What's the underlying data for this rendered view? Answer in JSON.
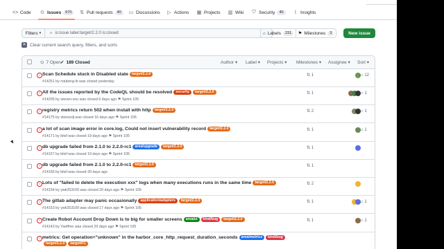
{
  "repo_tabs": {
    "code": "Code",
    "issues": "Issues",
    "issues_count": "670",
    "pulls": "Pull requests",
    "pulls_count": "40",
    "discussions": "Discussions",
    "actions": "Actions",
    "projects": "Projects",
    "wiki": "Wiki",
    "security": "Security",
    "security_count": "40",
    "insights": "Insights"
  },
  "filter_bar": {
    "filters_label": "Filters",
    "search_value": "is:issue label:target/2.2.0 is:closed",
    "labels_label": "Labels",
    "labels_count": "231",
    "milestones_label": "Milestones",
    "milestones_count": "3",
    "new_issue_label": "New issue"
  },
  "clear_text": "Clear current search query, filters, and sorts",
  "list_header": {
    "open": "7 Open",
    "closed": "189 Closed",
    "author": "Author",
    "label": "Label",
    "projects": "Projects",
    "milestones": "Milestones",
    "assignee": "Assignee",
    "sort": "Sort"
  },
  "label_colors": {
    "target": "#e46a1a",
    "security": "#d93f0b",
    "area": "#1f6feb",
    "application": "#d93f0b",
    "kind_bug": "#d73a4a",
    "area_ui": "#0e8a16",
    "area_metrics": "#1f6feb"
  },
  "issues": [
    {
      "title": "Scan Schedule stuck in Disabled state",
      "labels": [
        "target/2.2.0"
      ],
      "label_keys": [
        "target"
      ],
      "meta": "#14251 by rstuberg-ib was closed yesterday",
      "sprint": "",
      "prs": "1",
      "avatars": [
        "#6a9955"
      ],
      "comments": "12"
    },
    {
      "title": "All the issues reported by the CodeQL should be resolved",
      "labels": [
        "security",
        "target/2.2.0"
      ],
      "label_keys": [
        "security",
        "target"
      ],
      "meta": "#14205 by steven-zou was closed 6 days ago",
      "sprint": "Sprint 105",
      "prs": "1",
      "avatars": [
        "#8b6c4f",
        "#4a7a4a",
        "#333333"
      ],
      "comments": "1"
    },
    {
      "title": "registry metrics return 502 when install with http",
      "labels": [
        "target/2.2.0"
      ],
      "label_keys": [
        "target"
      ],
      "meta": "#14175 by stonezdj was closed 16 days ago",
      "sprint": "Sprint 105",
      "prs": "2",
      "avatars": [
        "#7a8a6a",
        "#333333"
      ],
      "comments": "1"
    },
    {
      "title": "a lot of scan image error in core.log, Could not insert vulnerability record",
      "labels": [
        "target/2.2.0"
      ],
      "label_keys": [
        "target"
      ],
      "meta": "#14171 by bitsf was closed 19 days ago",
      "sprint": "Sprint 105",
      "prs": "1",
      "avatars": [
        "#6a8a5a"
      ],
      "comments": "1"
    },
    {
      "title": "db upgrade failed from 2.1.0 to 2.2.0-rc1",
      "labels": [
        "area/upgrade",
        "target/2.2.0"
      ],
      "label_keys": [
        "area",
        "target"
      ],
      "meta": "#14157 by bitsf was closed 19 days ago",
      "sprint": "Sprint 105",
      "prs": "1",
      "avatars": [
        "#5b6ee1"
      ],
      "comments": ""
    },
    {
      "title": "db upgrade failed from 2.1.0 to 2.2.0-rc1",
      "labels": [
        "target/2.2.0"
      ],
      "label_keys": [
        "target"
      ],
      "meta": "#14156 by bitsf was closed 20 days ago",
      "sprint": "",
      "prs": "1",
      "avatars": [],
      "comments": ""
    },
    {
      "title": "Lots of \"failed to delete the execution xxx\" logs when many executions runs in the same time",
      "labels": [
        "target/2.2.0"
      ],
      "label_keys": [
        "target"
      ],
      "meta": "#14154 by ywk253100 was closed 20 days ago",
      "sprint": "Sprint 105",
      "prs": "2",
      "avatars": [
        "#f2b233"
      ],
      "comments": ""
    },
    {
      "title": "The gitlab adapter may panic occasionally",
      "labels": [
        "application/adapters",
        "target/2.2.0"
      ],
      "label_keys": [
        "application",
        "target"
      ],
      "meta": "#14153 by ywk253100 was closed 17 days ago",
      "sprint": "Sprint 105",
      "prs": "1",
      "avatars": [
        "#f2b233",
        "#5b6ee1"
      ],
      "comments": "1"
    },
    {
      "title": "Create Robot Account Drop Down is to big for smaller screens",
      "labels": [
        "area/ui",
        "kind/bug",
        "target/2.2.0"
      ],
      "label_keys": [
        "area_ui",
        "kind_bug",
        "target"
      ],
      "meta": "#14143 by Yaeffmo was closed 20 days ago",
      "sprint": "Sprint 105",
      "prs": "1",
      "avatars": [
        "#8b6c4f"
      ],
      "comments": "1"
    },
    {
      "title": "metrics: Get operation=\"unknown\" in the harbor_core_http_request_duration_seconds",
      "labels": [
        "area/metrics",
        "kind/bug"
      ],
      "label_keys": [
        "area_metrics",
        "kind_bug"
      ],
      "meta": "",
      "sprint": "",
      "prs": "",
      "avatars": [],
      "comments": "",
      "extra_labels": [
        "target/2.2.0",
        "target/FC"
      ]
    }
  ]
}
